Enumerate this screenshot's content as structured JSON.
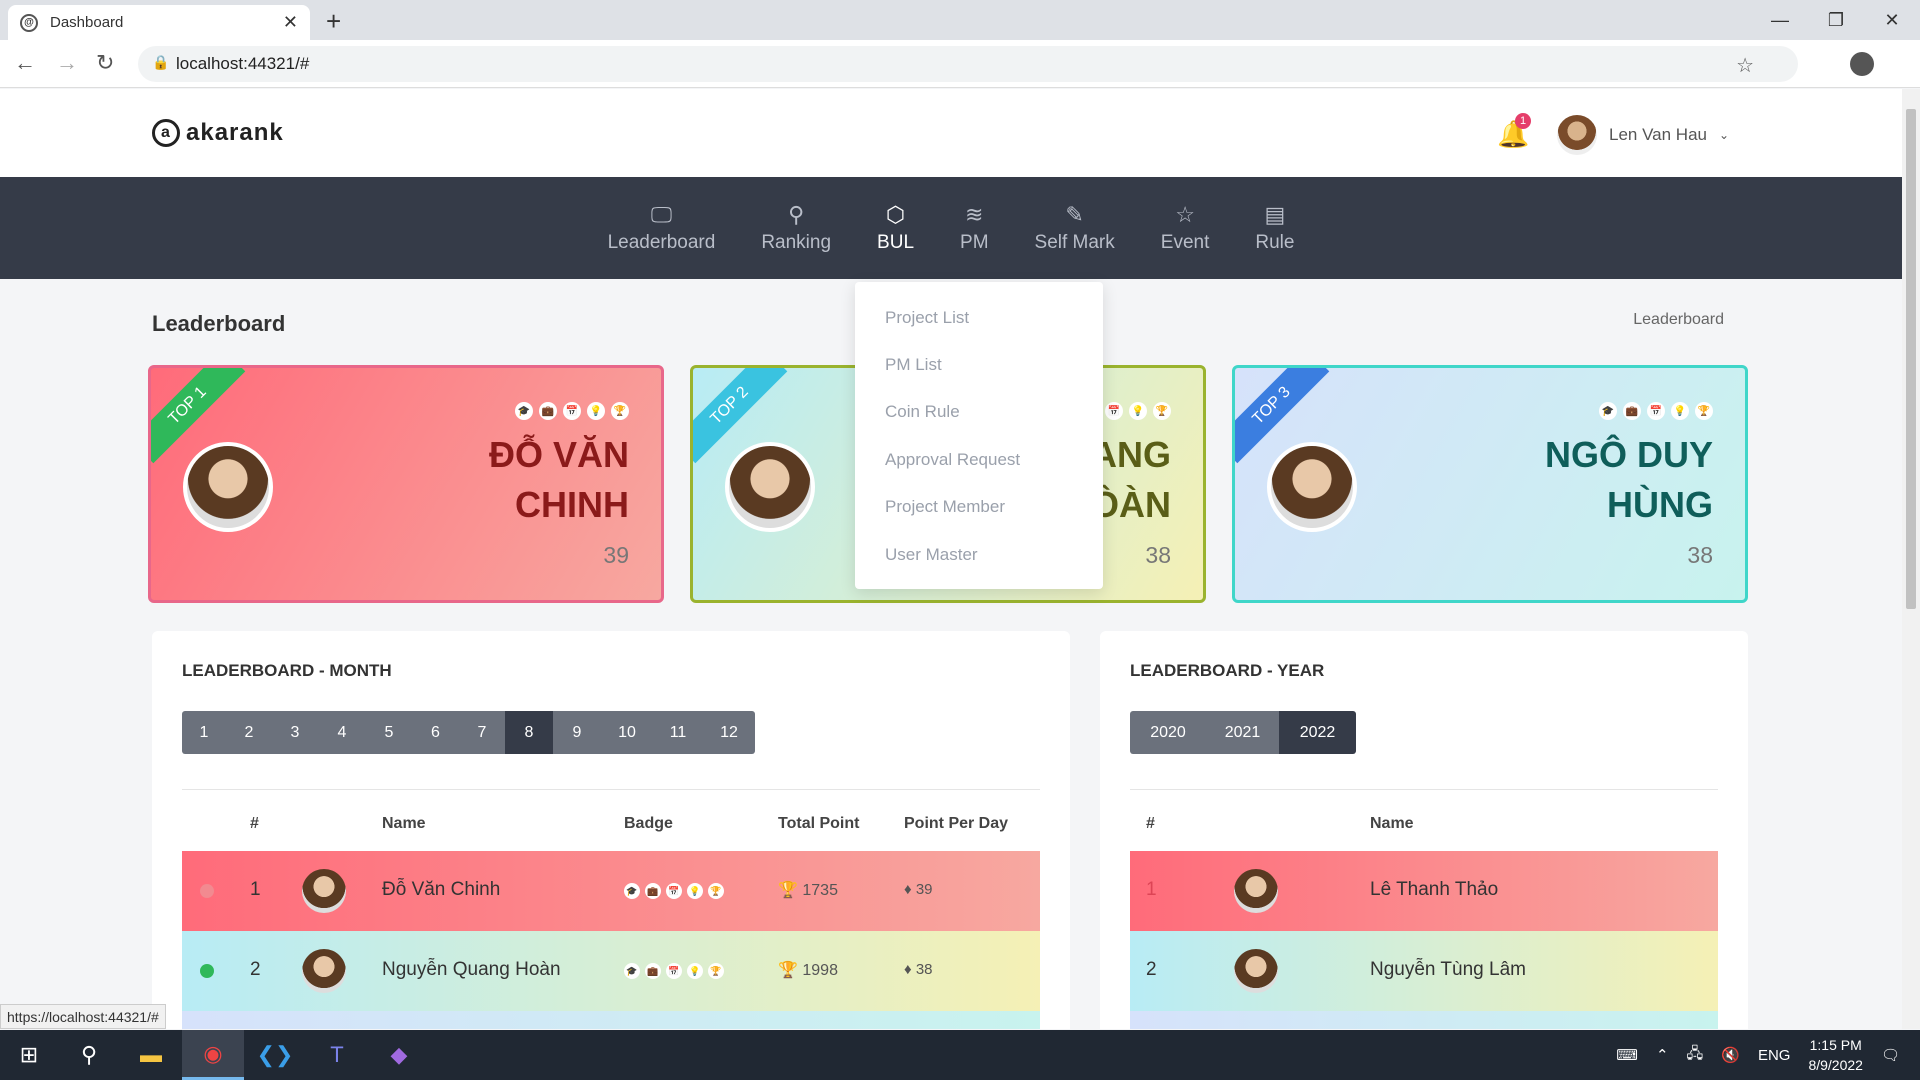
{
  "browser": {
    "tab_title": "Dashboard",
    "url": "localhost:44321/#",
    "status_url": "https://localhost:44321/#"
  },
  "header": {
    "logo_text": "akarank",
    "notification_count": "1",
    "user_name": "Len Van Hau"
  },
  "nav": {
    "items": [
      {
        "label": "Leaderboard",
        "icon": "monitor-icon"
      },
      {
        "label": "Ranking",
        "icon": "medal-icon"
      },
      {
        "label": "BUL",
        "icon": "cube-icon"
      },
      {
        "label": "PM",
        "icon": "layers-icon"
      },
      {
        "label": "Self Mark",
        "icon": "edit-icon"
      },
      {
        "label": "Event",
        "icon": "star-icon"
      },
      {
        "label": "Rule",
        "icon": "document-icon"
      }
    ],
    "active": "BUL"
  },
  "dropdown": {
    "items": [
      "Project List",
      "PM List",
      "Coin Rule",
      "Approval Request",
      "Project Member",
      "User Master"
    ]
  },
  "page": {
    "title": "Leaderboard",
    "breadcrumb": "Leaderboard"
  },
  "top_cards": [
    {
      "rank": "TOP 1",
      "name_line1": "ĐỖ VĂN",
      "name_line2": "CHINH",
      "points": "39"
    },
    {
      "rank": "TOP 2",
      "name_line1": "ANG",
      "name_line2": "ÒÀN",
      "points": "38"
    },
    {
      "rank": "TOP 3",
      "name_line1": "NGÔ DUY",
      "name_line2": "HÙNG",
      "points": "38"
    }
  ],
  "month_panel": {
    "title": "LEADERBOARD - MONTH",
    "months": [
      "1",
      "2",
      "3",
      "4",
      "5",
      "6",
      "7",
      "8",
      "9",
      "10",
      "11",
      "12"
    ],
    "selected": "8",
    "columns": [
      "#",
      "Name",
      "Badge",
      "Total Point",
      "Point Per Day"
    ],
    "rows": [
      {
        "rank": "1",
        "name": "Đỗ Văn Chinh",
        "total": "1735",
        "per_day": "39"
      },
      {
        "rank": "2",
        "name": "Nguyễn Quang Hoàn",
        "total": "1998",
        "per_day": "38"
      }
    ]
  },
  "year_panel": {
    "title": "LEADERBOARD - YEAR",
    "years": [
      "2020",
      "2021",
      "2022"
    ],
    "selected": "2022",
    "columns": [
      "#",
      "Name"
    ],
    "rows": [
      {
        "rank": "1",
        "name": "Lê Thanh Thảo"
      },
      {
        "rank": "2",
        "name": "Nguyễn Tùng Lâm"
      }
    ]
  },
  "taskbar": {
    "language": "ENG",
    "time": "1:15 PM",
    "date": "8/9/2022"
  }
}
